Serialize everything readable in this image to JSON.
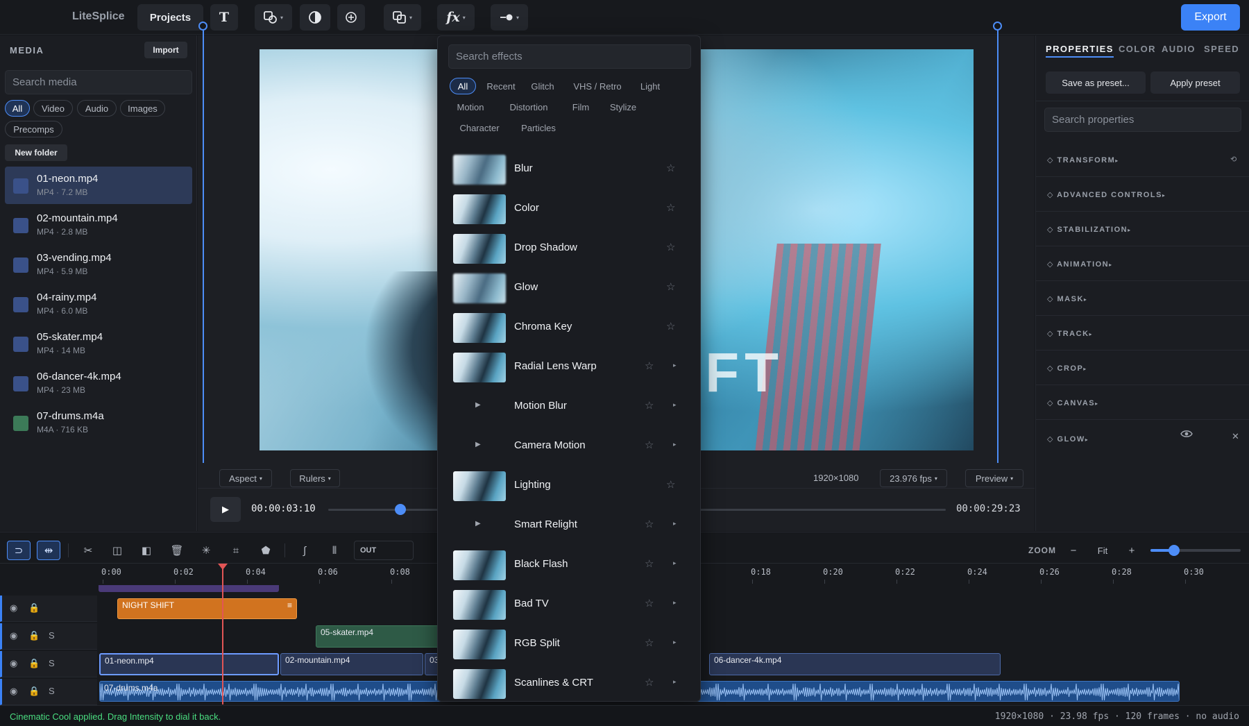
{
  "app": {
    "name": "LiteSplice"
  },
  "toolbar": {
    "projects_label": "Projects",
    "text_icon": "T",
    "fx_label": "fx",
    "export_label": "Export"
  },
  "media": {
    "title": "MEDIA",
    "import_label": "Import",
    "search_placeholder": "Search media",
    "filters": [
      "All",
      "Video",
      "Audio",
      "Images",
      "Precomps"
    ],
    "new_folder_label": "New folder",
    "items": [
      {
        "name": "01-neon.mp4",
        "meta": "MP4 · 7.2 MB"
      },
      {
        "name": "02-mountain.mp4",
        "meta": "MP4 · 2.8 MB"
      },
      {
        "name": "03-vending.mp4",
        "meta": "MP4 · 5.9 MB"
      },
      {
        "name": "04-rainy.mp4",
        "meta": "MP4 · 6.0 MB"
      },
      {
        "name": "05-skater.mp4",
        "meta": "MP4 · 14 MB"
      },
      {
        "name": "06-dancer-4k.mp4",
        "meta": "MP4 · 23 MB"
      },
      {
        "name": "07-drums.m4a",
        "meta": "M4A · 716 KB"
      }
    ]
  },
  "preview": {
    "overlay_text": "IFT",
    "aspect_label": "Aspect",
    "rulers_label": "Rulers",
    "resolution": "1920×1080",
    "fps_label": "23.976 fps",
    "preview_label": "Preview",
    "current_time": "00:00:03:10",
    "total_time": "00:00:29:23",
    "scrub_progress": 0.117
  },
  "effects": {
    "search_placeholder": "Search effects",
    "categories": [
      "All",
      "Recent",
      "Glitch",
      "VHS / Retro",
      "Light",
      "Motion",
      "Distortion",
      "Film",
      "Stylize",
      "Character",
      "Particles"
    ],
    "items": [
      {
        "name": "Blur"
      },
      {
        "name": "Color"
      },
      {
        "name": "Drop Shadow"
      },
      {
        "name": "Glow"
      },
      {
        "name": "Chroma Key"
      },
      {
        "name": "Radial Lens Warp"
      },
      {
        "name": "Motion Blur"
      },
      {
        "name": "Camera Motion"
      },
      {
        "name": "Lighting"
      },
      {
        "name": "Smart Relight"
      },
      {
        "name": "Black Flash"
      },
      {
        "name": "Bad TV"
      },
      {
        "name": "RGB Split"
      },
      {
        "name": "Scanlines & CRT"
      }
    ]
  },
  "properties": {
    "tabs": [
      "PROPERTIES",
      "COLOR",
      "AUDIO",
      "SPEED"
    ],
    "save_preset_label": "Save as preset...",
    "apply_preset_label": "Apply preset",
    "search_placeholder": "Search properties",
    "sections": [
      "TRANSFORM",
      "ADVANCED CONTROLS",
      "STABILIZATION",
      "ANIMATION",
      "MASK",
      "TRACK",
      "CROP",
      "CANVAS",
      "GLOW"
    ]
  },
  "timeline": {
    "out_label": "OUT",
    "zoom_label": "ZOOM",
    "fit_label": "Fit",
    "ruler": [
      "0:00",
      "0:02",
      "0:04",
      "0:06",
      "0:08",
      "0:18",
      "0:20",
      "0:22",
      "0:24",
      "0:26",
      "0:28",
      "0:30"
    ],
    "clips": {
      "title": "NIGHT SHIFT",
      "skater": "05-skater.mp4",
      "neon": "01-neon.mp4",
      "mountain": "02-mountain.mp4",
      "vending_short": "03",
      "dancer": "06-dancer-4k.mp4",
      "drums": "07-drums.m4a"
    },
    "solo_label": "S"
  },
  "status": {
    "message": "Cinematic Cool applied. Drag Intensity to dial it back.",
    "info": "1920×1080 · 23.98 fps · 120 frames · no audio"
  }
}
